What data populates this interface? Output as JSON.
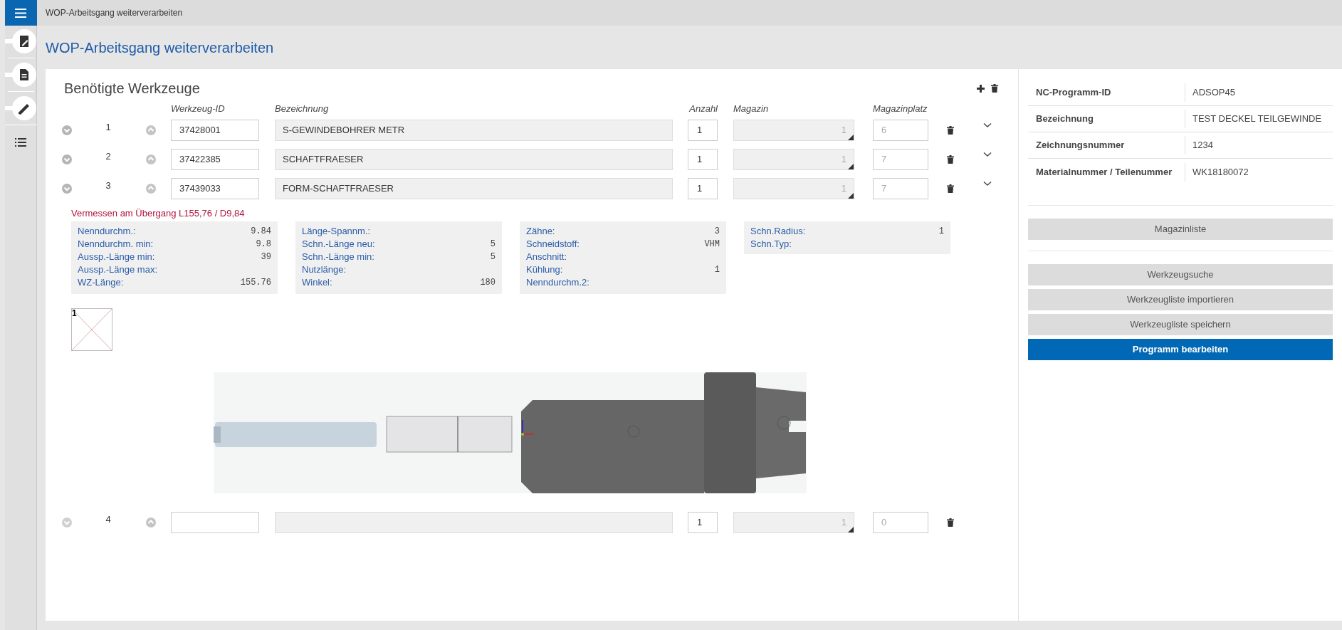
{
  "window": {
    "title": "WOP-Arbeitsgang weiterverarbeiten"
  },
  "page_title": "WOP-Arbeitsgang weiterverarbeiten",
  "tools": {
    "title": "Benötigte Werkzeuge",
    "columns": [
      "Werkzeug-ID",
      "Bezeichnung",
      "Anzahl",
      "Magazin",
      "Magazinplatz"
    ],
    "rows": [
      {
        "kind": "tool",
        "number": "1",
        "tool_id": "37428001",
        "name": "S-GEWINDEBOHRER METR",
        "count": "1",
        "magazine": "1",
        "slot": "6",
        "expanded": false
      },
      {
        "kind": "tool",
        "number": "2",
        "tool_id": "37422385",
        "name": "SCHAFTFRAESER",
        "count": "1",
        "magazine": "1",
        "slot": "7",
        "expanded": false
      },
      {
        "kind": "tool",
        "number": "3",
        "tool_id": "37439033",
        "name": "FORM-SCHAFTFRAESER",
        "count": "1",
        "magazine": "1",
        "slot": "7",
        "expanded": true,
        "measurement": "Vermessen am Übergang L155,76 / D9,84",
        "details": [
          [
            {
              "label": "Nenndurchm.:",
              "value": "9.84"
            },
            {
              "label": "Nenndurchm. min:",
              "value": "9.8"
            },
            {
              "label": "Aussp.-Länge min:",
              "value": "39"
            },
            {
              "label": "Aussp.-Länge max:"
            },
            {
              "label": "WZ-Länge:",
              "value": "155.76"
            }
          ],
          [
            {
              "label": "Länge-Spannm.:"
            },
            {
              "label": "Schn.-Länge neu:",
              "value": "5"
            },
            {
              "label": "Schn.-Länge min:",
              "value": "5"
            },
            {
              "label": "Nutzlänge:"
            },
            {
              "label": "Winkel:",
              "value": "180"
            }
          ],
          [
            {
              "label": "Zähne:",
              "value": "3"
            },
            {
              "label": "Schneidstoff:",
              "value": "VHM"
            },
            {
              "label": "Anschnitt:"
            },
            {
              "label": "Kühlung:",
              "value": "1"
            },
            {
              "label": "Nenndurchm.2:"
            }
          ],
          [
            {
              "label": "Schn.Radius:",
              "value": "1"
            },
            {
              "label": "Schn.Typ:"
            }
          ]
        ],
        "thumbnail_label": "1"
      },
      {
        "kind": "empty",
        "number": "4",
        "count": "1",
        "magazine": "1",
        "slot": "0",
        "expanded": false
      }
    ]
  },
  "program_info": [
    {
      "label": "NC-Programm-ID",
      "value": "ADSOP45"
    },
    {
      "label": "Bezeichnung",
      "value": "TEST DECKEL TEILGEWINDE"
    },
    {
      "label": "Zeichnungsnummer",
      "value": "1234"
    },
    {
      "label": "Materialnummer / Teilenummer",
      "value": "WK18180072"
    }
  ],
  "buttons": [
    {
      "label": "Magazinliste",
      "kind": "secondary",
      "divider_before": true
    },
    {
      "label": "Werkzeugsuche",
      "kind": "secondary",
      "divider_before": true
    },
    {
      "label": "Werkzeugliste importieren",
      "kind": "secondary",
      "divider_before": false
    },
    {
      "label": "Werkzeugliste speichern",
      "kind": "secondary",
      "divider_before": false
    },
    {
      "label": "Programm bearbeiten",
      "kind": "primary",
      "divider_before": false
    }
  ]
}
